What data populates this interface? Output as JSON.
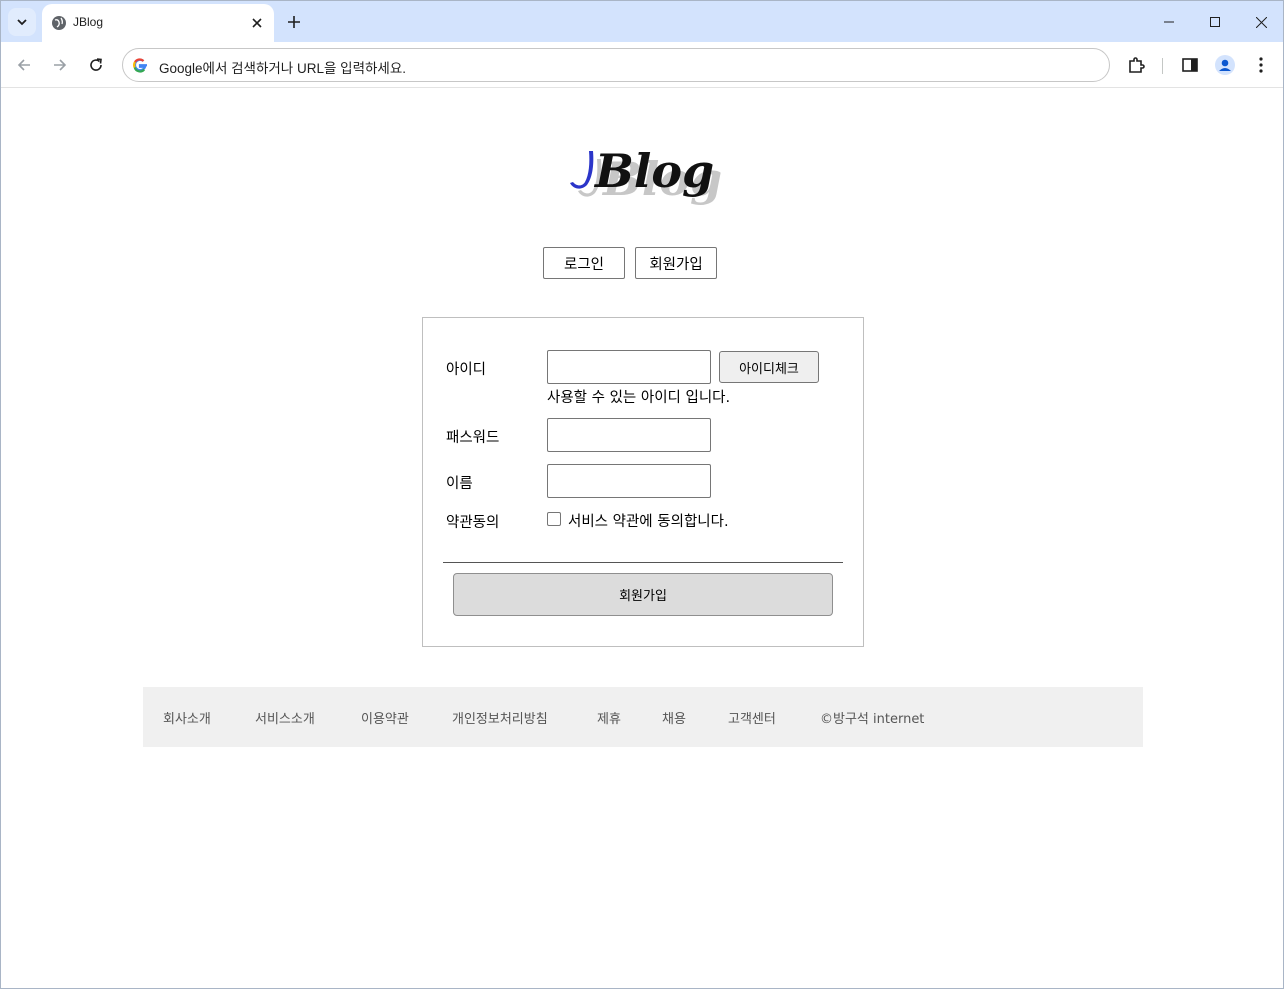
{
  "browser": {
    "tab_title": "JBlog",
    "omnibox_placeholder": "Google에서 검색하거나 URL을 입력하세요."
  },
  "header": {
    "logo_text": "JBlog",
    "login_label": "로그인",
    "join_label": "회원가입"
  },
  "form": {
    "id_label": "아이디",
    "id_value": "",
    "id_check_label": "아이디체크",
    "id_available_msg": "사용할 수 있는 아이디 입니다.",
    "password_label": "패스워드",
    "password_value": "",
    "name_label": "이름",
    "name_value": "",
    "agree_label": "약관동의",
    "agree_checkbox_label": "서비스 약관에 동의합니다.",
    "agree_checked": false,
    "submit_label": "회원가입"
  },
  "footer": {
    "links": [
      "회사소개",
      "서비스소개",
      "이용약관",
      "개인정보처리방침",
      "제휴",
      "채용",
      "고객센터"
    ],
    "copyright": "©방구석 internet"
  },
  "colors": {
    "tabbar_bg": "#d3e3fd",
    "logo_j": "#2b35c9",
    "footer_bg": "#f0f0f0"
  }
}
